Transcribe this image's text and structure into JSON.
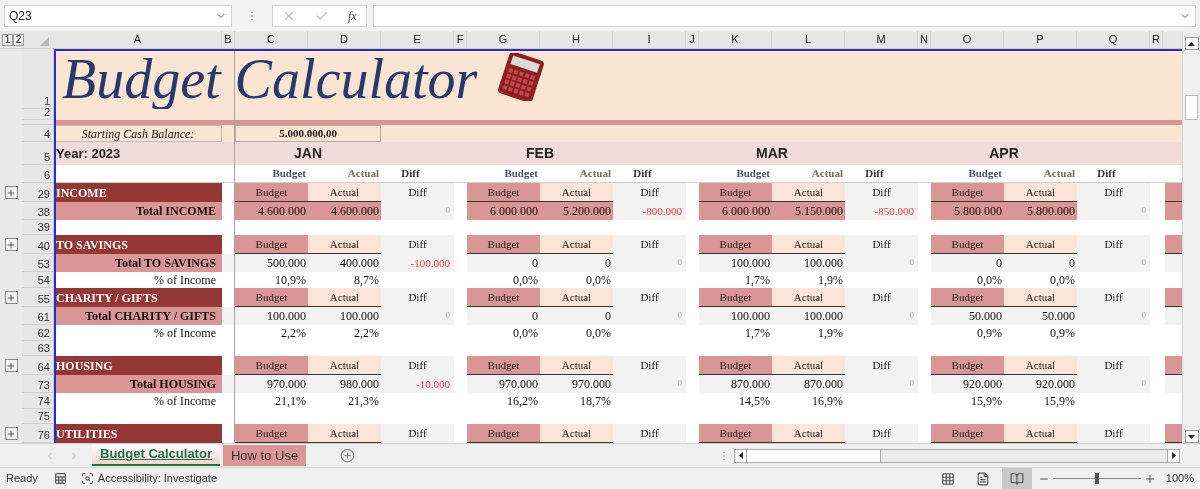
{
  "name_box": "Q23",
  "fx_label": "fx",
  "outline_levels": [
    "1",
    "2"
  ],
  "columns": [
    "A",
    "B",
    "C",
    "D",
    "E",
    "F",
    "G",
    "H",
    "I",
    "J",
    "K",
    "L",
    "M",
    "N",
    "O",
    "P",
    "Q",
    "R"
  ],
  "title_rows": [
    "1",
    "2"
  ],
  "title": "Budget Calculator",
  "starting_cash": {
    "row": "4",
    "label": "Starting Cash Balance:",
    "value": "5.000.000,00"
  },
  "year_row": {
    "row": "5",
    "label": "Year: 2023"
  },
  "labels_row": "6",
  "months": [
    {
      "name": "JAN",
      "labels": [
        "Budget",
        "Actual",
        "Diff"
      ]
    },
    {
      "name": "FEB",
      "labels": [
        "Budget",
        "Actual",
        "Diff"
      ]
    },
    {
      "name": "MAR",
      "labels": [
        "Budget",
        "Actual",
        "Diff"
      ]
    },
    {
      "name": "APR",
      "labels": [
        "Budget",
        "Actual",
        "Diff"
      ]
    }
  ],
  "rows": [
    {
      "number": "29",
      "kind": "section",
      "label": "INCOME",
      "cells": [
        {
          "budget": "Budget",
          "actual": "Actual",
          "diff": "Diff"
        },
        {
          "budget": "Budget",
          "actual": "Actual",
          "diff": "Diff"
        },
        {
          "budget": "Budget",
          "actual": "Actual",
          "diff": "Diff"
        },
        {
          "budget": "Budget",
          "actual": "Actual",
          "diff": "Diff"
        }
      ]
    },
    {
      "number": "38",
      "kind": "total",
      "label": "Total INCOME",
      "highlight": true,
      "cells": [
        {
          "budget": "4.600.000",
          "actual": "4.600.000",
          "diff": "0",
          "negative": false
        },
        {
          "budget": "6.000.000",
          "actual": "5.200.000",
          "diff": "-800.000",
          "negative": true
        },
        {
          "budget": "6.000.000",
          "actual": "5.150.000",
          "diff": "-850.000",
          "negative": true
        },
        {
          "budget": "5.800.000",
          "actual": "5.800.000",
          "diff": "0",
          "negative": false
        }
      ]
    },
    {
      "number": "39",
      "kind": "blank"
    },
    {
      "number": "40",
      "kind": "section",
      "label": "TO SAVINGS",
      "cells": [
        {
          "budget": "Budget",
          "actual": "Actual",
          "diff": "Diff"
        },
        {
          "budget": "Budget",
          "actual": "Actual",
          "diff": "Diff"
        },
        {
          "budget": "Budget",
          "actual": "Actual",
          "diff": "Diff"
        },
        {
          "budget": "Budget",
          "actual": "Actual",
          "diff": "Diff"
        }
      ]
    },
    {
      "number": "53",
      "kind": "total",
      "label": "Total TO SAVINGS",
      "highlight": false,
      "cells": [
        {
          "budget": "500.000",
          "actual": "400.000",
          "diff": "-100.000",
          "negative": true
        },
        {
          "budget": "0",
          "actual": "0",
          "diff": "0",
          "negative": false
        },
        {
          "budget": "100.000",
          "actual": "100.000",
          "diff": "0",
          "negative": false
        },
        {
          "budget": "0",
          "actual": "0",
          "diff": "0",
          "negative": false
        }
      ]
    },
    {
      "number": "54",
      "kind": "percent",
      "label": "% of Income",
      "cells": [
        {
          "budget": "10,9%",
          "actual": "8,7%"
        },
        {
          "budget": "0,0%",
          "actual": "0,0%"
        },
        {
          "budget": "1,7%",
          "actual": "1,9%"
        },
        {
          "budget": "0,0%",
          "actual": "0,0%"
        }
      ]
    },
    {
      "number": "55",
      "kind": "section",
      "label": "CHARITY / GIFTS",
      "cells": [
        {
          "budget": "Budget",
          "actual": "Actual",
          "diff": "Diff"
        },
        {
          "budget": "Budget",
          "actual": "Actual",
          "diff": "Diff"
        },
        {
          "budget": "Budget",
          "actual": "Actual",
          "diff": "Diff"
        },
        {
          "budget": "Budget",
          "actual": "Actual",
          "diff": "Diff"
        }
      ]
    },
    {
      "number": "61",
      "kind": "total",
      "label": "Total CHARITY / GIFTS",
      "highlight": false,
      "cells": [
        {
          "budget": "100.000",
          "actual": "100.000",
          "diff": "0",
          "negative": false
        },
        {
          "budget": "0",
          "actual": "0",
          "diff": "0",
          "negative": false
        },
        {
          "budget": "100.000",
          "actual": "100.000",
          "diff": "0",
          "negative": false
        },
        {
          "budget": "50.000",
          "actual": "50.000",
          "diff": "0",
          "negative": false
        }
      ]
    },
    {
      "number": "62",
      "kind": "percent",
      "label": "% of Income",
      "cells": [
        {
          "budget": "2,2%",
          "actual": "2,2%"
        },
        {
          "budget": "0,0%",
          "actual": "0,0%"
        },
        {
          "budget": "1,7%",
          "actual": "1,9%"
        },
        {
          "budget": "0,9%",
          "actual": "0,9%"
        }
      ]
    },
    {
      "number": "63",
      "kind": "blank"
    },
    {
      "number": "64",
      "kind": "section",
      "label": "HOUSING",
      "cells": [
        {
          "budget": "Budget",
          "actual": "Actual",
          "diff": "Diff"
        },
        {
          "budget": "Budget",
          "actual": "Actual",
          "diff": "Diff"
        },
        {
          "budget": "Budget",
          "actual": "Actual",
          "diff": "Diff"
        },
        {
          "budget": "Budget",
          "actual": "Actual",
          "diff": "Diff"
        }
      ]
    },
    {
      "number": "73",
      "kind": "total",
      "label": "Total HOUSING",
      "highlight": false,
      "cells": [
        {
          "budget": "970.000",
          "actual": "980.000",
          "diff": "-10.000",
          "negative": true
        },
        {
          "budget": "970.000",
          "actual": "970.000",
          "diff": "0",
          "negative": false
        },
        {
          "budget": "870.000",
          "actual": "870.000",
          "diff": "0",
          "negative": false
        },
        {
          "budget": "920.000",
          "actual": "920.000",
          "diff": "0",
          "negative": false
        }
      ]
    },
    {
      "number": "74",
      "kind": "percent",
      "label": "% of Income",
      "cells": [
        {
          "budget": "21,1%",
          "actual": "21,3%"
        },
        {
          "budget": "16,2%",
          "actual": "18,7%"
        },
        {
          "budget": "14,5%",
          "actual": "16,9%"
        },
        {
          "budget": "15,9%",
          "actual": "15,9%"
        }
      ]
    },
    {
      "number": "75",
      "kind": "blank"
    },
    {
      "number": "76",
      "kind": "section",
      "label": "UTILITIES",
      "cells": [
        {
          "budget": "Budget",
          "actual": "Actual",
          "diff": "Diff"
        },
        {
          "budget": "Budget",
          "actual": "Actual",
          "diff": "Diff"
        },
        {
          "budget": "Budget",
          "actual": "Actual",
          "diff": "Diff"
        },
        {
          "budget": "Budget",
          "actual": "Actual",
          "diff": "Diff"
        }
      ]
    }
  ],
  "sheet_tabs": [
    {
      "label": "Budget Calculator",
      "selected": true
    },
    {
      "label": "How to Use",
      "selected": false
    }
  ],
  "status_bar": {
    "mode": "Ready",
    "accessibility": "Accessibility: Investigate",
    "zoom": "100%",
    "zoom_slider": {
      "level": 0.5
    }
  }
}
